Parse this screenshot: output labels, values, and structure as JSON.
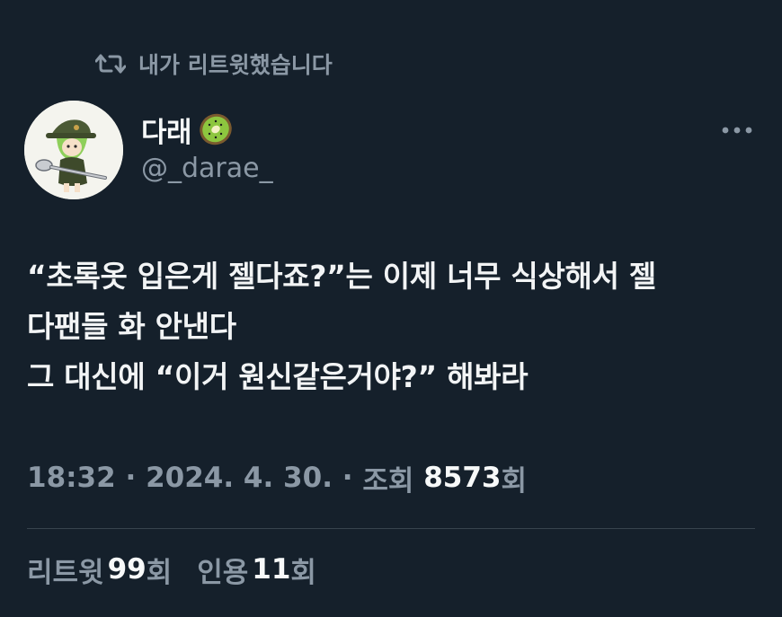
{
  "social_context": {
    "icon": "retweet-icon",
    "text": "내가 리트윗했습니다"
  },
  "author": {
    "display_name": "다래",
    "name_emoji": "kiwi-icon",
    "handle": "@_darae_",
    "avatar": "avatar-character-with-spoon"
  },
  "more_icon": "more-horizontal-icon",
  "tweet": {
    "lines": [
      "“초록옷 입은게 젤다죠?”는 이제 너무 식상해서 젤",
      "다팬들 화 안낸다",
      "그 대신에 “이거 원신같은거야?” 해봐라"
    ]
  },
  "meta": {
    "time": "18:32",
    "sep1": " · ",
    "date": "2024. 4. 30.",
    "sep2": " · ",
    "views_label_prefix": "조회 ",
    "views_count": "8573",
    "views_label_suffix": "회"
  },
  "stats": {
    "retweets_label": "리트윗",
    "retweets_count": "99",
    "retweets_suffix": "회",
    "quotes_label": "인용",
    "quotes_count": "11",
    "quotes_suffix": "회"
  },
  "colors": {
    "background": "#15202b",
    "secondary_text": "#8b98a5",
    "primary_text": "#f7f9f9",
    "divider": "#38444d"
  }
}
